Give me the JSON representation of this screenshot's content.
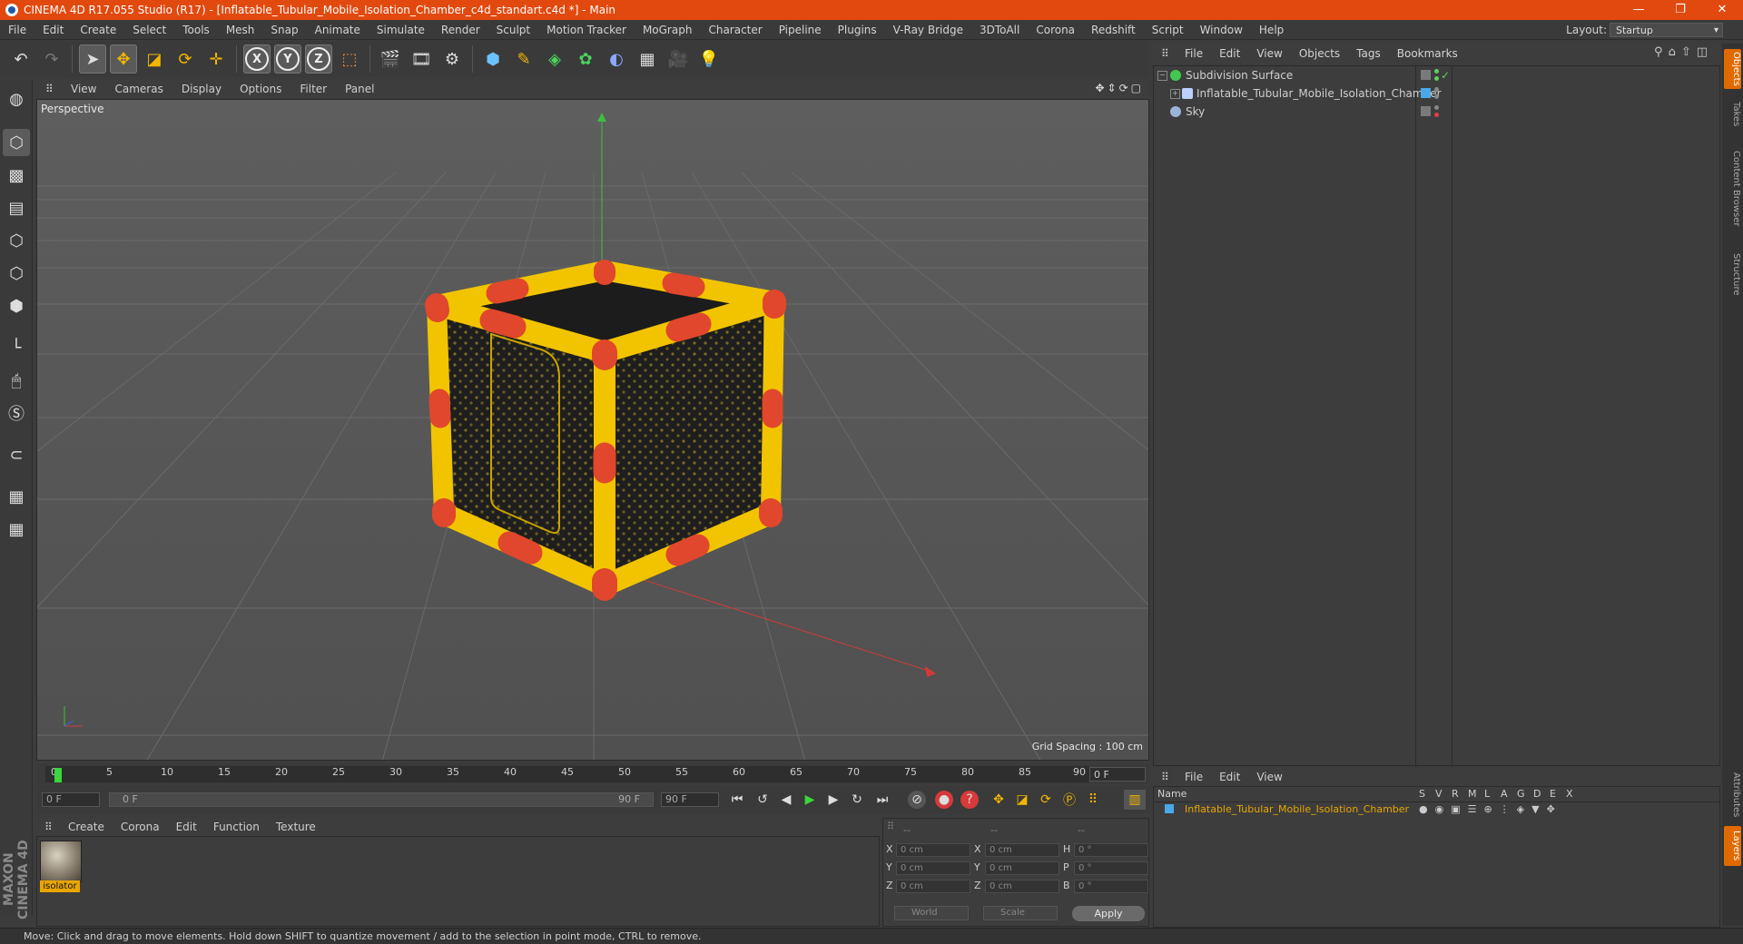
{
  "window": {
    "title": "CINEMA 4D R17.055 Studio (R17) - [Inflatable_Tubular_Mobile_Isolation_Chamber_c4d_standart.c4d *] - Main",
    "minimize": "—",
    "restore": "❐",
    "close": "✕"
  },
  "menubar": {
    "items": [
      "File",
      "Edit",
      "Create",
      "Select",
      "Tools",
      "Mesh",
      "Snap",
      "Animate",
      "Simulate",
      "Render",
      "Sculpt",
      "Motion Tracker",
      "MoGraph",
      "Character",
      "Pipeline",
      "Plugins",
      "V-Ray Bridge",
      "3DToAll",
      "Corona",
      "Redshift",
      "Script",
      "Window",
      "Help"
    ],
    "layout_label": "Layout:",
    "layout_value": "Startup"
  },
  "viewport": {
    "menu": [
      "View",
      "Cameras",
      "Display",
      "Options",
      "Filter",
      "Panel"
    ],
    "label": "Perspective",
    "grid_spacing": "Grid Spacing : 100 cm",
    "nav_icons": "✥⇕⟳▢"
  },
  "object_manager": {
    "menu": [
      "File",
      "Edit",
      "View",
      "Objects",
      "Tags",
      "Bookmarks"
    ],
    "objects": [
      {
        "name": "Subdivision Surface",
        "expand": "−",
        "check": "✓"
      },
      {
        "name": "Inflatable_Tubular_Mobile_Isolation_Chamber",
        "expand": "+"
      },
      {
        "name": "Sky"
      }
    ]
  },
  "side_tabs": [
    "Objects",
    "Takes",
    "Content Browser",
    "Structure",
    "Attributes",
    "Layers"
  ],
  "timeline": {
    "ticks": [
      "0",
      "5",
      "10",
      "15",
      "20",
      "25",
      "30",
      "35",
      "40",
      "45",
      "50",
      "55",
      "60",
      "65",
      "70",
      "75",
      "80",
      "85",
      "90"
    ],
    "current_frame": "0 F",
    "start_field": "0 F",
    "range_start": "0 F",
    "range_end": "90 F",
    "end_field": "90 F"
  },
  "material_manager": {
    "menu": [
      "Create",
      "Corona",
      "Edit",
      "Function",
      "Texture"
    ],
    "materials": [
      {
        "name": "isolator"
      }
    ]
  },
  "coordinates": {
    "headers": [
      "--",
      "--",
      "--"
    ],
    "rows": [
      {
        "a": "X",
        "av": "0 cm",
        "b": "X",
        "bv": "0 cm",
        "c": "H",
        "cv": "0 °"
      },
      {
        "a": "Y",
        "av": "0 cm",
        "b": "Y",
        "bv": "0 cm",
        "c": "P",
        "cv": "0 °"
      },
      {
        "a": "Z",
        "av": "0 cm",
        "b": "Z",
        "bv": "0 cm",
        "c": "B",
        "cv": "0 °"
      }
    ],
    "space": "World",
    "mode": "Scale",
    "apply": "Apply"
  },
  "layer_manager": {
    "menu": [
      "File",
      "Edit",
      "View"
    ],
    "columns": [
      "Name",
      "S",
      "V",
      "R",
      "M",
      "L",
      "A",
      "G",
      "D",
      "E",
      "X"
    ],
    "layers": [
      {
        "name": "Inflatable_Tubular_Mobile_Isolation_Chamber"
      }
    ]
  },
  "status": {
    "text": "Move: Click and drag to move elements. Hold down SHIFT to quantize movement / add to the selection in point mode, CTRL to remove."
  },
  "branding": {
    "text": "MAXON CINEMA 4D"
  },
  "colors": {
    "title_bar": "#e2490f",
    "accent": "#e8a600",
    "tube_yellow": "#f2c400",
    "tube_red": "#e0472c"
  }
}
